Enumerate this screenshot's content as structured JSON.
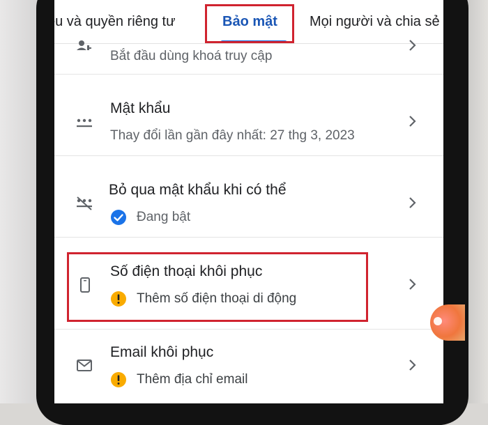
{
  "tabs": [
    {
      "label": "ệu và quyền riêng tư"
    },
    {
      "label": "Bảo mật",
      "selected": true
    },
    {
      "label": "Mọi người và chia sẻ"
    }
  ],
  "rows": {
    "passkey": {
      "subtitle": "Bắt đầu dùng khoá truy cập"
    },
    "password": {
      "title": "Mật khẩu",
      "subtitle": "Thay đổi lần gần đây nhất: 27 thg 3, 2023"
    },
    "skip_password": {
      "title": "Bỏ qua mật khẩu khi có thể",
      "status": "Đang bật"
    },
    "recovery_phone": {
      "title": "Số điện thoại khôi phục",
      "status": "Thêm số điện thoại di động"
    },
    "recovery_email": {
      "title": "Email khôi phục",
      "status": "Thêm địa chỉ email"
    }
  },
  "colors": {
    "accent": "#1a73e8",
    "selected_tab_text": "#1a56b5",
    "highlight": "#d0232f",
    "warning": "#f9ab00",
    "check": "#1a73e8"
  },
  "icons": {
    "passkey": "passkey-icon",
    "password": "password-dots-icon",
    "skip_password": "password-off-icon",
    "recovery_phone": "smartphone-icon",
    "recovery_email": "mail-icon",
    "chevron": "chevron-right-icon"
  }
}
